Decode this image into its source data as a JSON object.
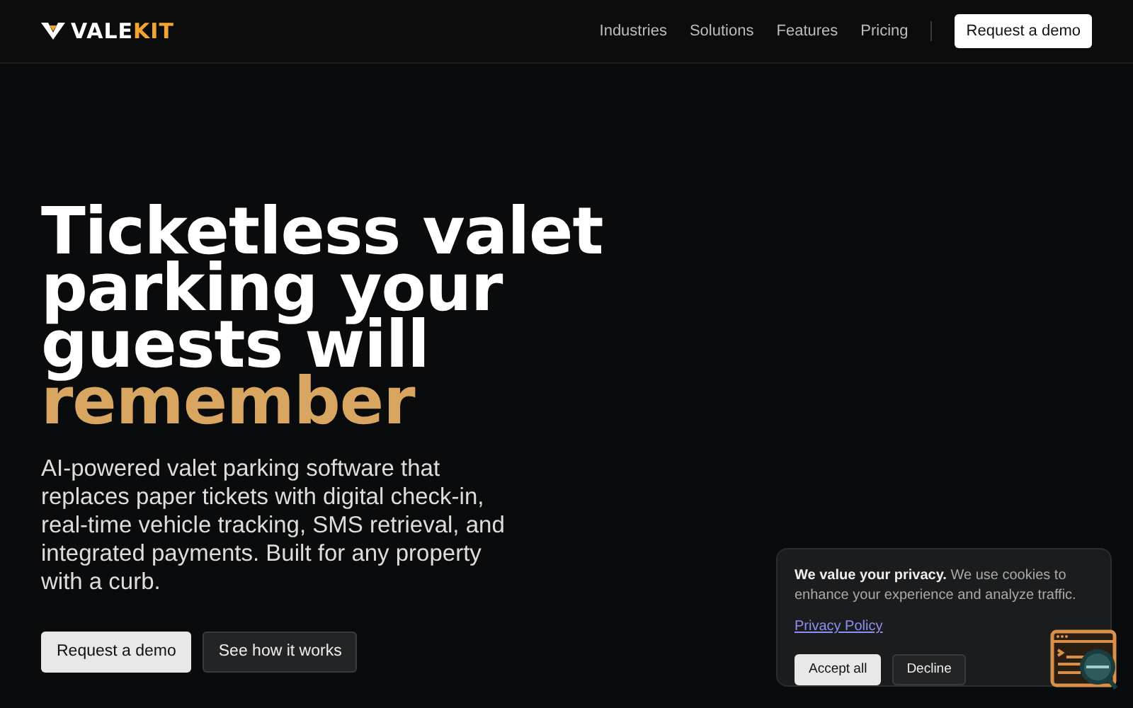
{
  "navbar": {
    "logo": {
      "lead": "VALE",
      "accent": "KIT"
    },
    "links": [
      "Industries",
      "Solutions",
      "Features",
      "Pricing"
    ],
    "cta": "Request a demo"
  },
  "hero": {
    "headline": "Ticketless valet parking your guests will",
    "headline_accent": "remember",
    "description": "AI-powered valet parking software that replaces paper tickets with digital check-in, real-time vehicle tracking, SMS retrieval, and integrated payments. Built for any property with a curb.",
    "buttons": [
      {
        "label": "Request a demo",
        "kind": "primary"
      },
      {
        "label": "See how it works",
        "kind": "secondary"
      }
    ]
  },
  "cookie_banner": {
    "message": "**We value your privacy.** We use cookies to enhance your experience and analyze traffic.",
    "link": "Privacy Policy",
    "buttons": [
      {
        "label": "Accept all",
        "kind": "primary"
      },
      {
        "label": "Decline",
        "kind": "secondary"
      }
    ]
  }
}
